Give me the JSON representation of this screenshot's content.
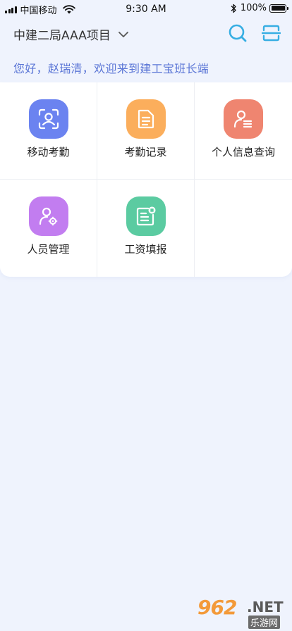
{
  "status_bar": {
    "carrier": "中国移动",
    "time": "9:30 AM",
    "battery": "100%"
  },
  "header": {
    "project_name": "中建二局AAA项目",
    "icons": {
      "dropdown": "chevron-down-icon",
      "search": "search-icon",
      "scan": "scan-icon"
    }
  },
  "greeting": "您好，赵瑞清，欢迎来到建工宝班长端",
  "menu": [
    {
      "label": "移动考勤",
      "icon": "face-scan-icon",
      "color": "#6b83f0"
    },
    {
      "label": "考勤记录",
      "icon": "document-icon",
      "color": "#fbae5c"
    },
    {
      "label": "个人信息查询",
      "icon": "person-info-icon",
      "color": "#ef8570"
    },
    {
      "label": "人员管理",
      "icon": "person-settings-icon",
      "color": "#c27df0"
    },
    {
      "label": "工资填报",
      "icon": "form-fill-icon",
      "color": "#5bcba1"
    }
  ],
  "watermark": {
    "brand": "962",
    "suffix": ".NET",
    "cn": "乐游网"
  },
  "colors": {
    "background": "#eff3fd",
    "greeting": "#5b76d6",
    "header_icon": "#37aee3"
  }
}
